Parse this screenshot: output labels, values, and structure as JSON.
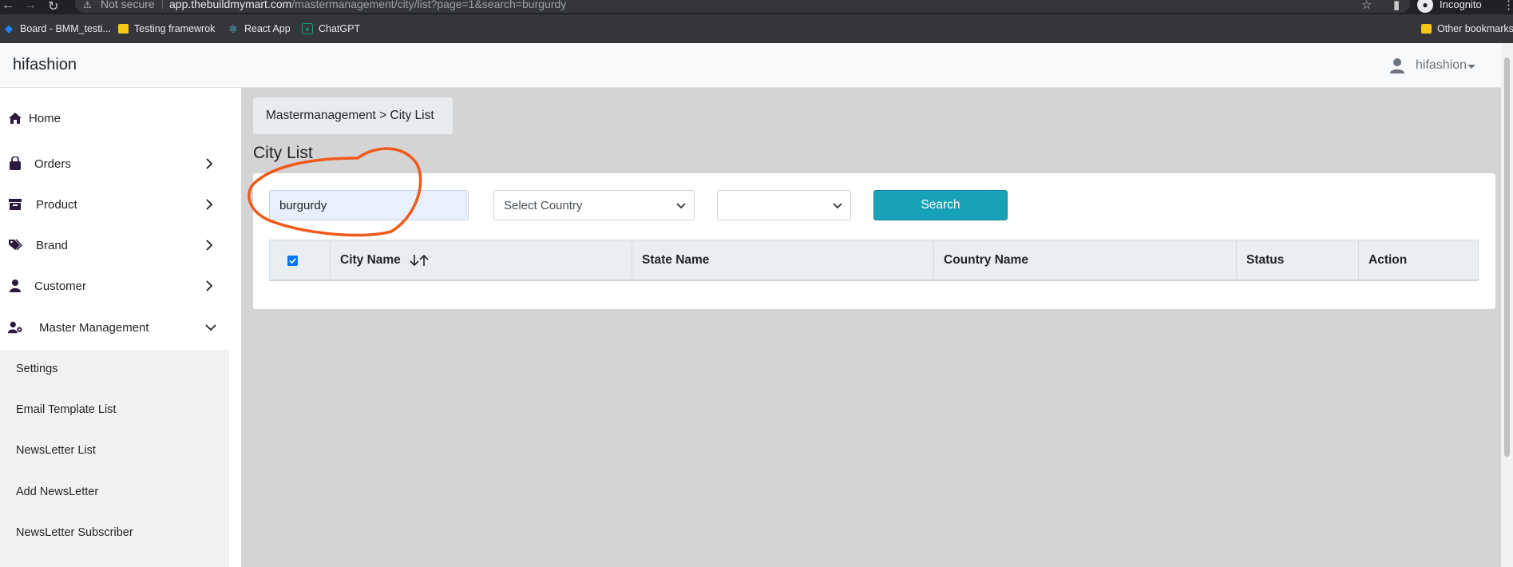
{
  "browser": {
    "secure_label": "Not secure",
    "url_host": "app.thebuildmymart.com",
    "url_path": "/mastermanagement/city/list?page=1&search=burgurdy",
    "profile_label": "Incognito",
    "bookmarks": [
      {
        "label": "Board - BMM_testi...",
        "icon": "jira-icon"
      },
      {
        "label": "Testing framewrok",
        "icon": "folder-icon"
      },
      {
        "label": "React App",
        "icon": "react-icon"
      },
      {
        "label": "ChatGPT",
        "icon": "chatgpt-icon"
      }
    ],
    "other_bookmarks": "Other bookmarks"
  },
  "header": {
    "brand": "hifashion",
    "user": "hifashion"
  },
  "sidebar": {
    "items": [
      {
        "label": "Home",
        "icon": "home-icon"
      },
      {
        "label": "Orders",
        "icon": "shopping-bag-icon"
      },
      {
        "label": "Product",
        "icon": "archive-box-icon"
      },
      {
        "label": "Brand",
        "icon": "tags-icon"
      },
      {
        "label": "Customer",
        "icon": "user-icon"
      },
      {
        "label": "Master Management",
        "icon": "user-gear-icon"
      }
    ],
    "sub_items": [
      {
        "label": "Settings"
      },
      {
        "label": "Email Template List"
      },
      {
        "label": "NewsLetter List"
      },
      {
        "label": "Add NewsLetter"
      },
      {
        "label": "NewsLetter Subscriber"
      }
    ]
  },
  "main": {
    "breadcrumb": "Mastermanagement > City List",
    "title": "City List",
    "filters": {
      "search_value": "burgurdy",
      "country_select": "Select Country",
      "state_select": "",
      "search_button": "Search"
    },
    "table": {
      "columns": [
        "City Name",
        "State Name",
        "Country Name",
        "Status",
        "Action"
      ]
    }
  },
  "colors": {
    "accent": "#17a2b8",
    "annotation": "#f05a1a",
    "content_bg": "#d4d4d4"
  }
}
